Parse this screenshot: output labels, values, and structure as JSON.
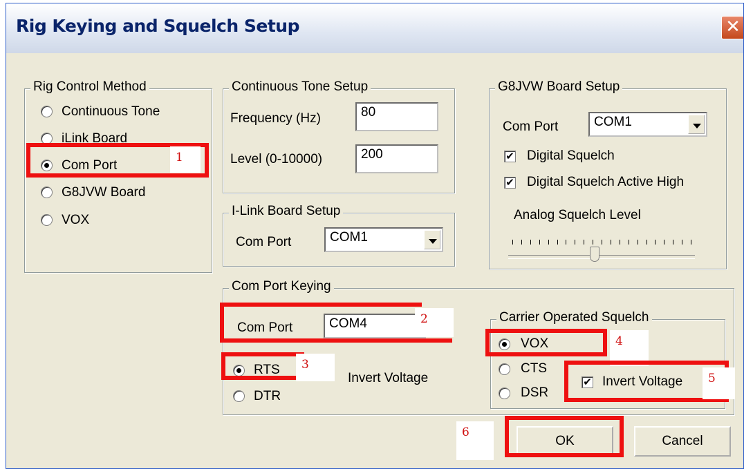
{
  "window": {
    "title": "Rig Keying and Squelch Setup",
    "close_glyph": "✕"
  },
  "rig_control": {
    "legend": "Rig Control Method",
    "options": [
      {
        "label": "Continuous Tone",
        "selected": false
      },
      {
        "label": "iLink Board",
        "selected": false
      },
      {
        "label": "Com Port",
        "selected": true
      },
      {
        "label": "G8JVW Board",
        "selected": false
      },
      {
        "label": "VOX",
        "selected": false
      }
    ]
  },
  "continuous_tone": {
    "legend": "Continuous Tone Setup",
    "frequency_label": "Frequency (Hz)",
    "frequency_value": "80",
    "level_label": "Level (0-10000)",
    "level_value": "200"
  },
  "ilink": {
    "legend": "I-Link Board Setup",
    "com_port_label": "Com Port",
    "com_port_value": "COM1"
  },
  "g8jvw": {
    "legend": "G8JVW Board Setup",
    "com_port_label": "Com Port",
    "com_port_value": "COM1",
    "digital_squelch_label": "Digital Squelch",
    "digital_squelch_checked": true,
    "digital_active_high_label": "Digital Squelch Active High",
    "digital_active_high_checked": true,
    "analog_label": "Analog Squelch Level",
    "analog_level_fraction": 0.46
  },
  "com_port_keying": {
    "legend": "Com Port Keying",
    "com_port_label": "Com Port",
    "com_port_value": "COM4",
    "rts_label": "RTS",
    "rts_selected": true,
    "dtr_label": "DTR",
    "dtr_selected": false,
    "invert_label": "Invert Voltage"
  },
  "carrier_squelch": {
    "legend": "Carrier Operated Squelch",
    "vox_label": "VOX",
    "vox_selected": true,
    "cts_label": "CTS",
    "cts_selected": false,
    "dsr_label": "DSR",
    "dsr_selected": false,
    "invert_label": "Invert Voltage",
    "invert_checked": true
  },
  "buttons": {
    "ok": "OK",
    "cancel": "Cancel"
  },
  "annotations": {
    "n1": "1",
    "n2": "2",
    "n3": "3",
    "n4": "4",
    "n5": "5",
    "n6": "6",
    "color": "#ee1010"
  },
  "colors": {
    "dialog_bg": "#ece9d8",
    "title_text": "#0a246a",
    "close_button": "#d5562f"
  }
}
